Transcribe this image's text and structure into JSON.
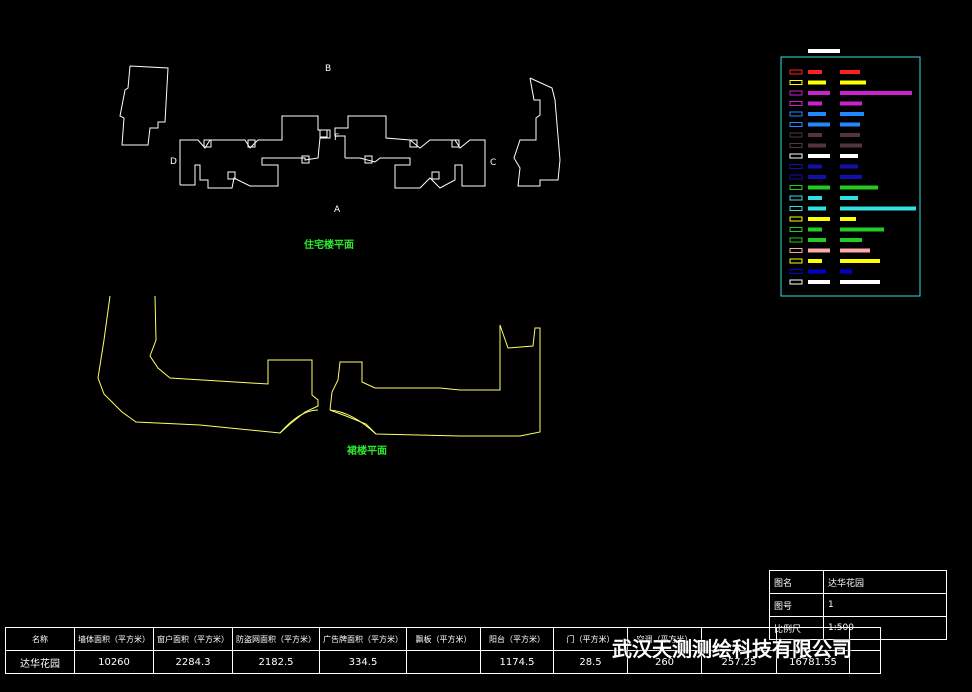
{
  "labels": {
    "b": "B",
    "a": "A",
    "c": "C",
    "d": "D",
    "f": "F",
    "upper_plan_title": "住宅楼平面",
    "lower_plan_title": "裙楼平面"
  },
  "summary_table": {
    "headers": [
      "名称",
      "墙体面积（平方米）",
      "窗户面积（平方米）",
      "防盗网面积（平方米）",
      "广告牌面积（平方米）",
      "飘板（平方米）",
      "阳台（平方米）",
      "门（平方米）",
      "空调（平方米）",
      "",
      "",
      ""
    ],
    "values": [
      "达华花园",
      "10260",
      "2284.3",
      "2182.5",
      "334.5",
      "",
      "1174.5",
      "28.5",
      "260",
      "257.25",
      "16781.55",
      ""
    ]
  },
  "title_block": {
    "rows": [
      {
        "key": "图名",
        "value": "达华花园"
      },
      {
        "key": "图号",
        "value": "1"
      },
      {
        "key": "比例尺",
        "value": "1:500"
      }
    ]
  },
  "watermark": "武汉天测测绘科技有限公司",
  "legend_colors": [
    "#ffffff",
    "#ff2020",
    "#ffff00",
    "#cc22cc",
    "#2288ff",
    "#553344",
    "#1111aa",
    "#22cc22",
    "#33e0e0",
    "#ffaaaa",
    "#0000cc"
  ]
}
